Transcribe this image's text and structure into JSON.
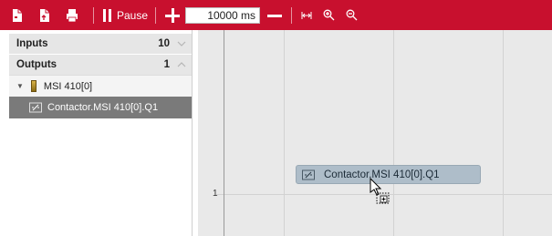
{
  "colors": {
    "toolbar_bg": "#c8102e",
    "selected_row_bg": "#7a7a7a",
    "drag_chip_bg": "#aebdc9"
  },
  "toolbar": {
    "icons": [
      "new-icon",
      "export-icon",
      "print-icon"
    ],
    "pause_label": "Pause",
    "interval_value": "10000 ms",
    "zoom_icons": [
      "fit-width-icon",
      "zoom-in-icon",
      "zoom-out-icon"
    ]
  },
  "sidebar": {
    "groups": [
      {
        "label": "Inputs",
        "count": "10",
        "state": "collapsed"
      },
      {
        "label": "Outputs",
        "count": "1",
        "state": "expanded"
      }
    ],
    "tree": {
      "module_label": "MSI 410[0]",
      "item_label": "Contactor.MSI 410[0].Q1"
    }
  },
  "plot": {
    "y_tick_label": "1",
    "drag_item_label": "Contactor.MSI 410[0].Q1"
  }
}
